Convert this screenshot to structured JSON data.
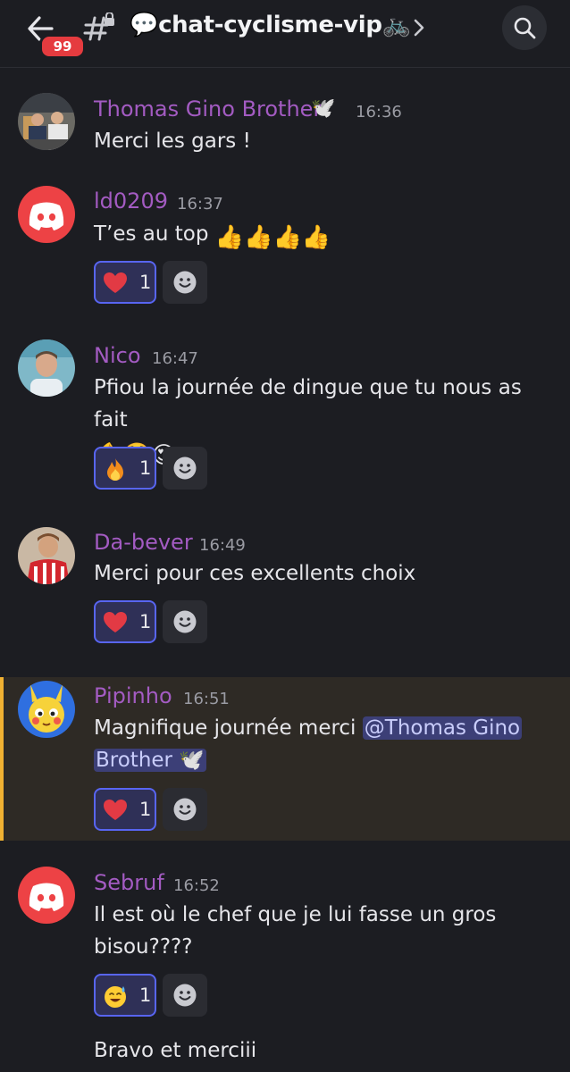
{
  "header": {
    "unread_badge": "99",
    "channel_title": "💬chat-cyclisme-vip🚲"
  },
  "messages": [
    {
      "author": "Thomas Gino Brother",
      "author_emoji": "🕊️",
      "time": "16:36",
      "text": "Merci les gars !"
    },
    {
      "author": "ld0209",
      "time": "16:37",
      "text": "T’es au top",
      "text_emoji": "👍👍👍👍",
      "reaction_emoji": "❤️",
      "reaction_count": "1"
    },
    {
      "author": "Nico",
      "time": "16:47",
      "text": "Pfiou la journée de dingue que tu nous as fait",
      "text_emoji": "💪🤑😍",
      "reaction_emoji": "🔥",
      "reaction_count": "1"
    },
    {
      "author": "Da-bever",
      "time": "16:49",
      "text": "Merci pour ces excellents choix",
      "reaction_emoji": "❤️",
      "reaction_count": "1"
    },
    {
      "author": "Pipinho",
      "time": "16:51",
      "text": "Magnifique journée merci ",
      "mention_line1": "@Thomas Gino",
      "mention_line2": "Brother",
      "mention_emoji": "🕊️",
      "reaction_emoji": "❤️",
      "reaction_count": "1"
    },
    {
      "author": "Sebruf",
      "time": "16:52",
      "text_line1": "Il est où le chef que je lui fasse un gros",
      "text_line2": "bisou????",
      "reaction_emoji": "😅",
      "reaction_count": "1",
      "followup": "Bravo et merciii"
    }
  ],
  "colors": {
    "accent": "#5865f2",
    "username": "#a35bc2",
    "badge": "#e53b3f",
    "highlight_bar": "#f0b132"
  }
}
